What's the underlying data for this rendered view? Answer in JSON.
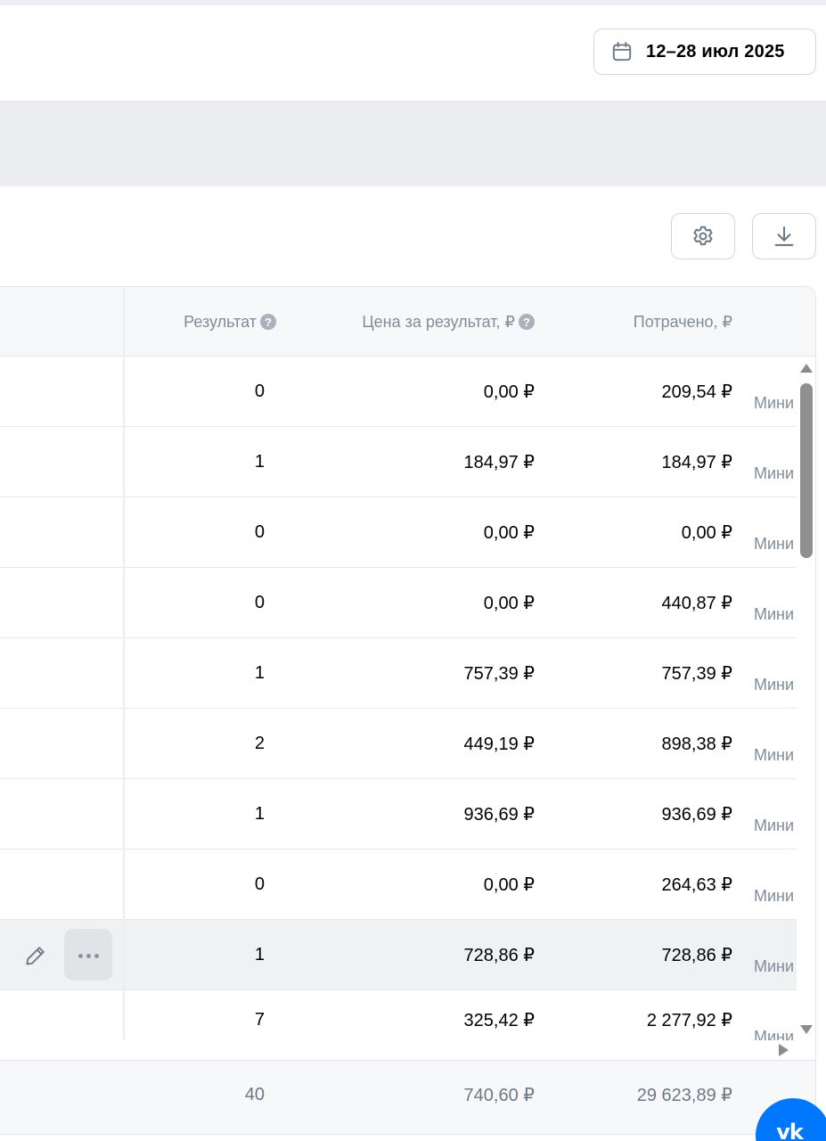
{
  "header": {
    "date_range": "12–28 июл 2025"
  },
  "toolbar": {
    "settings_icon": "gear-icon",
    "download_icon": "download-icon"
  },
  "table": {
    "columns": {
      "result": "Результат",
      "price": "Цена за результат, ₽",
      "spent": "Потрачено, ₽",
      "help_glyph": "?"
    },
    "rows": [
      {
        "result": "0",
        "price": "0,00 ₽",
        "spent": "209,54 ₽",
        "extra": "Мини"
      },
      {
        "result": "1",
        "price": "184,97 ₽",
        "spent": "184,97 ₽",
        "extra": "Мини"
      },
      {
        "result": "0",
        "price": "0,00 ₽",
        "spent": "0,00 ₽",
        "extra": "Мини"
      },
      {
        "result": "0",
        "price": "0,00 ₽",
        "spent": "440,87 ₽",
        "extra": "Мини"
      },
      {
        "result": "1",
        "price": "757,39 ₽",
        "spent": "757,39 ₽",
        "extra": "Мини"
      },
      {
        "result": "2",
        "price": "449,19 ₽",
        "spent": "898,38 ₽",
        "extra": "Мини"
      },
      {
        "result": "1",
        "price": "936,69 ₽",
        "spent": "936,69 ₽",
        "extra": "Мини"
      },
      {
        "result": "0",
        "price": "0,00 ₽",
        "spent": "264,63 ₽",
        "extra": "Мини"
      },
      {
        "result": "1",
        "price": "728,86 ₽",
        "spent": "728,86 ₽",
        "extra": "Мини"
      },
      {
        "result": "7",
        "price": "325,42 ₽",
        "spent": "2 277,92 ₽",
        "extra": "Мини"
      }
    ],
    "totals": {
      "result": "40",
      "price": "740,60 ₽",
      "spent": "29 623,89 ₽"
    }
  },
  "badge": {
    "label": "vk"
  },
  "colors": {
    "accent": "#0077ff",
    "muted_text": "#818c99",
    "hover_row": "#f0f1f3"
  }
}
